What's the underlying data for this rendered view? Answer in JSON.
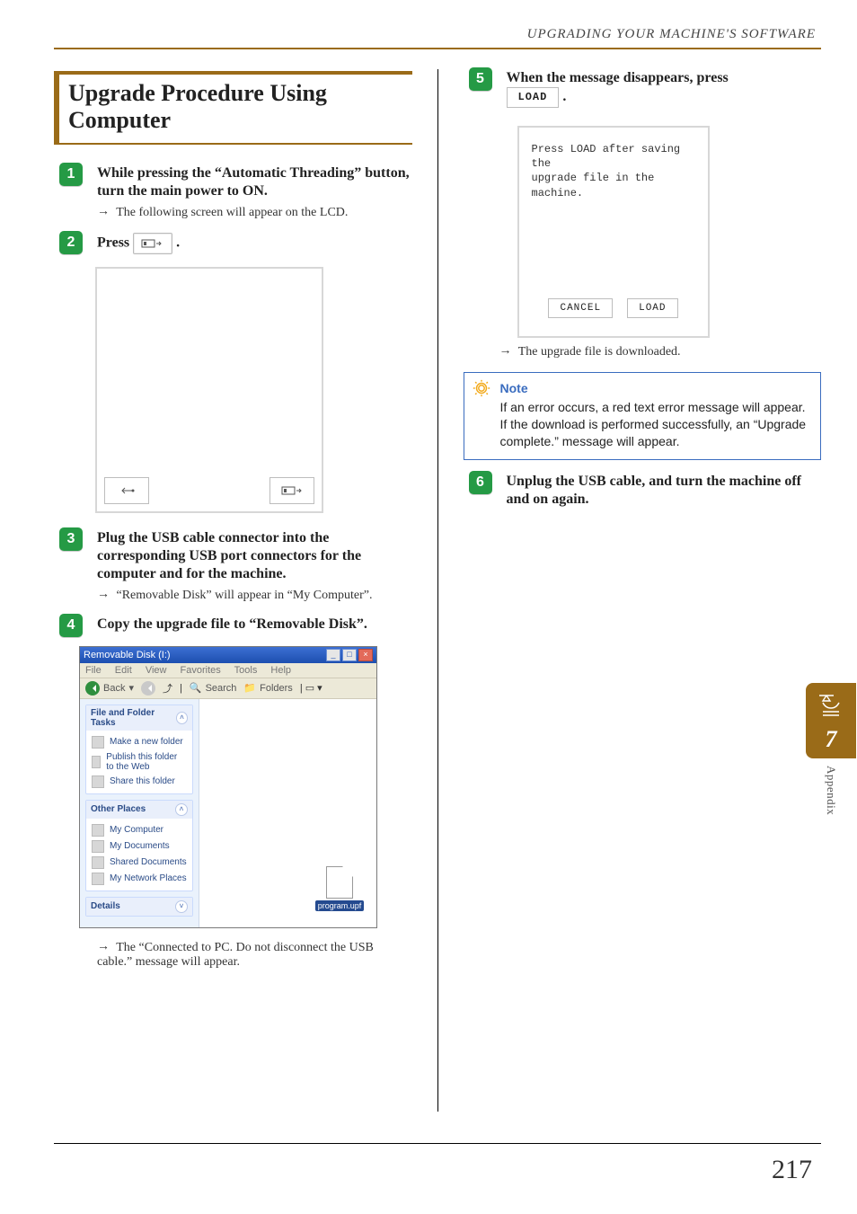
{
  "header": {
    "running_title": "UPGRADING YOUR MACHINE'S SOFTWARE"
  },
  "section_title": "Upgrade Procedure Using Computer",
  "steps": {
    "s1": {
      "num": "1",
      "title": "While pressing the “Automatic Threading” button, turn the main power to ON.",
      "result": "The following screen will appear on the LCD."
    },
    "s2": {
      "num": "2",
      "title_prefix": "Press",
      "title_suffix": "."
    },
    "s3": {
      "num": "3",
      "title": "Plug the USB cable connector into the corresponding USB port connectors for the computer and for the machine.",
      "result": "“Removable Disk” will appear in “My Computer”."
    },
    "s4": {
      "num": "4",
      "title": "Copy the upgrade file to “Removable Disk”.",
      "result": "The “Connected to PC. Do not disconnect the USB cable.” message will appear."
    },
    "s5": {
      "num": "5",
      "title_prefix": "When the message disappears, press",
      "load_label": "LOAD",
      "title_suffix": ".",
      "lcd_line1": "Press LOAD after saving the",
      "lcd_line2": "upgrade file in the",
      "lcd_line3": "machine.",
      "btn_cancel": "CANCEL",
      "btn_load": "LOAD",
      "result": "The upgrade file is downloaded."
    },
    "note": {
      "title": "Note",
      "body": "If an error occurs, a red text error message will appear. If the download is performed successfully, an “Upgrade complete.” message will appear."
    },
    "s6": {
      "num": "6",
      "title": "Unplug the USB cable, and turn the machine off and on again."
    }
  },
  "explorer": {
    "title": "Removable Disk (I:)",
    "menu": [
      "File",
      "Edit",
      "View",
      "Favorites",
      "Tools",
      "Help"
    ],
    "toolbar": {
      "back": "Back",
      "search": "Search",
      "folders": "Folders"
    },
    "tasks1": {
      "title": "File and Folder Tasks",
      "items": [
        "Make a new folder",
        "Publish this folder to the Web",
        "Share this folder"
      ]
    },
    "tasks2": {
      "title": "Other Places",
      "items": [
        "My Computer",
        "My Documents",
        "Shared Documents",
        "My Network Places"
      ]
    },
    "tasks3": {
      "title": "Details"
    },
    "file_label": "program.upf"
  },
  "sidetab": {
    "chapter": "7",
    "label": "Appendix"
  },
  "page_number": "217",
  "arrow_glyph": "→"
}
